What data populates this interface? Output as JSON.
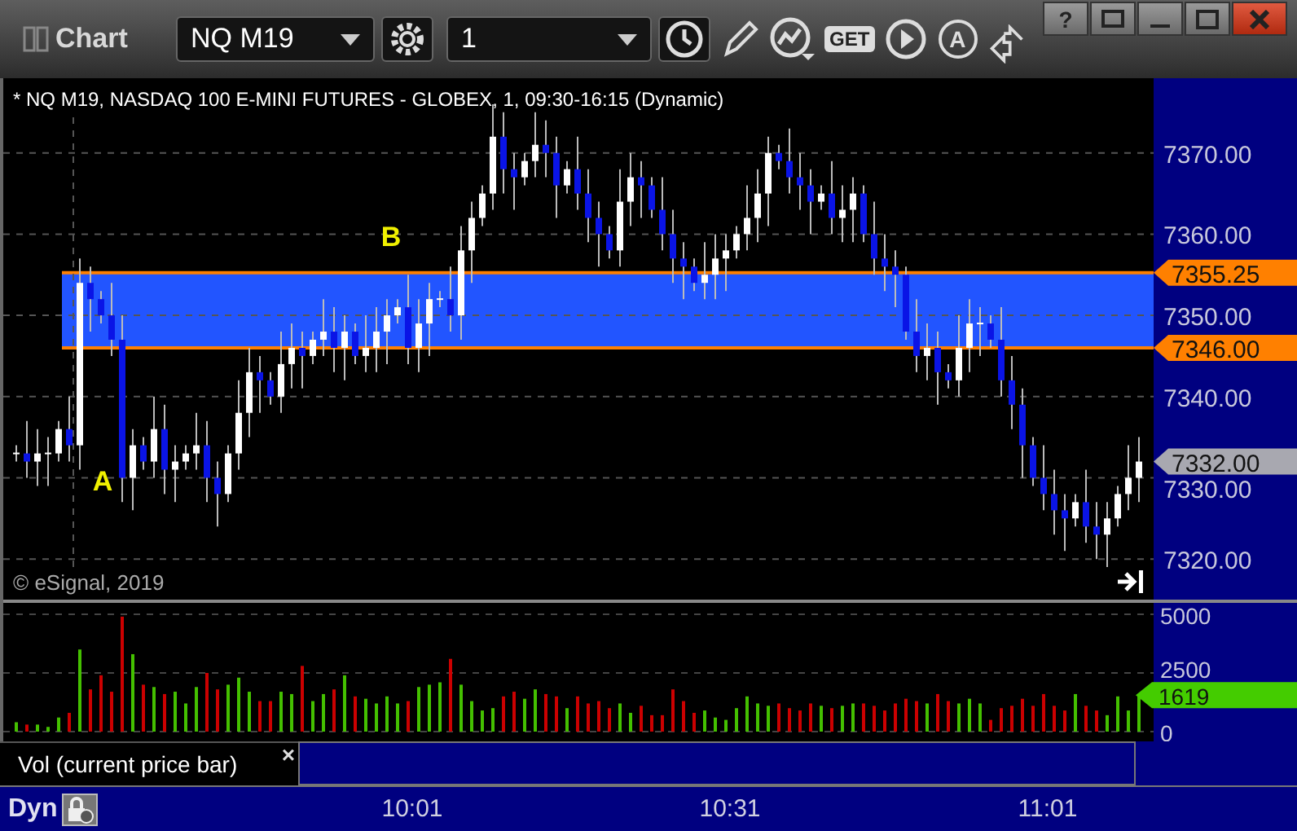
{
  "window": {
    "title": "Chart",
    "help_label": "?"
  },
  "toolbar": {
    "symbol": "NQ M19",
    "interval": "1",
    "get_label": "GET",
    "annotate_label": "A"
  },
  "price_pane": {
    "header": "* NQ M19, NASDAQ 100 E-MINI FUTURES - GLOBEX, 1, 09:30-16:15 (Dynamic)",
    "copyright": "© eSignal, 2019",
    "annotations": [
      "A",
      "B"
    ],
    "chart_data": {
      "type": "candlestick",
      "ylim": [
        7315,
        7379.2
      ],
      "grid": true,
      "yticks": [
        {
          "value": 7370,
          "label": "7370.00"
        },
        {
          "value": 7360,
          "label": "7360.00"
        },
        {
          "value": 7350,
          "label": "7350.00"
        },
        {
          "value": 7340,
          "label": "7340.00"
        },
        {
          "value": 7330,
          "label": "7330.00"
        },
        {
          "value": 7320,
          "label": "7320.00"
        }
      ],
      "ohlc": [
        [
          7333,
          7334,
          7332,
          7333
        ],
        [
          7333,
          7337,
          7330,
          7332
        ],
        [
          7332,
          7336,
          7329,
          7333
        ],
        [
          7333,
          7335,
          7329,
          7333
        ],
        [
          7333,
          7337,
          7332,
          7336
        ],
        [
          7336,
          7340,
          7332,
          7334
        ],
        [
          7334,
          7357,
          7331,
          7354
        ],
        [
          7354,
          7356,
          7348,
          7352
        ],
        [
          7352,
          7353,
          7349,
          7350
        ],
        [
          7350,
          7354,
          7345,
          7347
        ],
        [
          7347,
          7350,
          7327,
          7330
        ],
        [
          7330,
          7336,
          7326,
          7334
        ],
        [
          7334,
          7335,
          7331,
          7332
        ],
        [
          7332,
          7340,
          7330,
          7336
        ],
        [
          7336,
          7339,
          7328,
          7331
        ],
        [
          7331,
          7334,
          7327,
          7332
        ],
        [
          7332,
          7334,
          7331,
          7333
        ],
        [
          7333,
          7338,
          7331,
          7334
        ],
        [
          7334,
          7337,
          7327,
          7330
        ],
        [
          7330,
          7332,
          7324,
          7328
        ],
        [
          7328,
          7334,
          7327,
          7333
        ],
        [
          7333,
          7342,
          7331,
          7338
        ],
        [
          7338,
          7346,
          7335,
          7343
        ],
        [
          7343,
          7345,
          7338,
          7342
        ],
        [
          7342,
          7343,
          7339,
          7340
        ],
        [
          7340,
          7348,
          7338,
          7344
        ],
        [
          7344,
          7349,
          7341,
          7346
        ],
        [
          7346,
          7348,
          7341,
          7345
        ],
        [
          7345,
          7348,
          7344,
          7347
        ],
        [
          7347,
          7352,
          7345,
          7348
        ],
        [
          7348,
          7351,
          7343,
          7346
        ],
        [
          7346,
          7350,
          7342,
          7348
        ],
        [
          7348,
          7349,
          7344,
          7345
        ],
        [
          7345,
          7350,
          7343,
          7346
        ],
        [
          7346,
          7351,
          7343,
          7348
        ],
        [
          7348,
          7352,
          7344,
          7350
        ],
        [
          7350,
          7352,
          7349,
          7351
        ],
        [
          7351,
          7355,
          7344,
          7346
        ],
        [
          7346,
          7352,
          7343,
          7349
        ],
        [
          7349,
          7354,
          7345,
          7352
        ],
        [
          7352,
          7353,
          7351,
          7352
        ],
        [
          7352,
          7356,
          7348,
          7350
        ],
        [
          7350,
          7361,
          7347,
          7358
        ],
        [
          7358,
          7364,
          7354,
          7362
        ],
        [
          7362,
          7366,
          7361,
          7365
        ],
        [
          7365,
          7376,
          7363,
          7372
        ],
        [
          7372,
          7375,
          7365,
          7368
        ],
        [
          7368,
          7370,
          7363,
          7367
        ],
        [
          7367,
          7370,
          7366,
          7369
        ],
        [
          7369,
          7375,
          7367,
          7371
        ],
        [
          7371,
          7374,
          7367,
          7370
        ],
        [
          7370,
          7372,
          7362,
          7366
        ],
        [
          7366,
          7369,
          7365,
          7368
        ],
        [
          7368,
          7372,
          7363,
          7365
        ],
        [
          7365,
          7368,
          7359,
          7362
        ],
        [
          7362,
          7364,
          7356,
          7360
        ],
        [
          7360,
          7361,
          7357,
          7358
        ],
        [
          7358,
          7368,
          7356,
          7364
        ],
        [
          7364,
          7370,
          7361,
          7367
        ],
        [
          7367,
          7369,
          7362,
          7366
        ],
        [
          7366,
          7367,
          7362,
          7363
        ],
        [
          7363,
          7367,
          7358,
          7360
        ],
        [
          7360,
          7363,
          7354,
          7357
        ],
        [
          7357,
          7359,
          7352,
          7356
        ],
        [
          7356,
          7357,
          7353,
          7354
        ],
        [
          7354,
          7359,
          7352,
          7355
        ],
        [
          7355,
          7360,
          7352,
          7357
        ],
        [
          7357,
          7360,
          7353,
          7358
        ],
        [
          7358,
          7361,
          7357,
          7360
        ],
        [
          7360,
          7366,
          7358,
          7362
        ],
        [
          7362,
          7368,
          7359,
          7365
        ],
        [
          7365,
          7372,
          7361,
          7370
        ],
        [
          7370,
          7371,
          7368,
          7369
        ],
        [
          7369,
          7373,
          7365,
          7367
        ],
        [
          7367,
          7370,
          7363,
          7366
        ],
        [
          7366,
          7368,
          7360,
          7364
        ],
        [
          7364,
          7366,
          7363,
          7365
        ],
        [
          7365,
          7369,
          7360,
          7362
        ],
        [
          7362,
          7366,
          7359,
          7363
        ],
        [
          7363,
          7367,
          7359,
          7365
        ],
        [
          7365,
          7366,
          7359,
          7360
        ],
        [
          7360,
          7364,
          7355,
          7357
        ],
        [
          7357,
          7360,
          7353,
          7356
        ],
        [
          7356,
          7358,
          7351,
          7355
        ],
        [
          7355,
          7356,
          7347,
          7348
        ],
        [
          7348,
          7352,
          7343,
          7345
        ],
        [
          7345,
          7349,
          7342,
          7346
        ],
        [
          7346,
          7348,
          7339,
          7343
        ],
        [
          7343,
          7344,
          7341,
          7342
        ],
        [
          7342,
          7350,
          7340,
          7346
        ],
        [
          7346,
          7352,
          7343,
          7349
        ],
        [
          7349,
          7351,
          7345,
          7349
        ],
        [
          7349,
          7350,
          7346,
          7347
        ],
        [
          7347,
          7351,
          7340,
          7342
        ],
        [
          7342,
          7345,
          7336,
          7339
        ],
        [
          7339,
          7341,
          7330,
          7334
        ],
        [
          7334,
          7335,
          7329,
          7330
        ],
        [
          7330,
          7334,
          7326,
          7328
        ],
        [
          7328,
          7331,
          7323,
          7326
        ],
        [
          7326,
          7328,
          7321,
          7325
        ],
        [
          7325,
          7328,
          7324,
          7327
        ],
        [
          7327,
          7331,
          7322,
          7324
        ],
        [
          7324,
          7327,
          7320,
          7323
        ],
        [
          7323,
          7327,
          7319,
          7325
        ],
        [
          7325,
          7329,
          7324,
          7328
        ],
        [
          7328,
          7334,
          7326,
          7330
        ],
        [
          7330,
          7335,
          7327,
          7332
        ]
      ]
    },
    "zone_markers": [
      {
        "text": "7355.25",
        "color": "#ff8000"
      },
      {
        "text": "7346.00",
        "color": "#ff8000"
      }
    ],
    "last_price": {
      "text": "7332.00",
      "color": "#a8a8b0"
    }
  },
  "volume_pane": {
    "chart_data": {
      "type": "bar",
      "grid": true,
      "ylim": [
        0,
        5000
      ],
      "yticks": [
        0,
        2500,
        5000
      ],
      "series": [
        {
          "color": "#44c000",
          "values": [
            400,
            null,
            300,
            200,
            600,
            null,
            3500,
            null,
            null,
            null,
            null,
            3300,
            null,
            1900,
            null,
            1700,
            1200,
            1900,
            null,
            null,
            2000,
            2300,
            1700,
            null,
            null,
            1700,
            1600,
            null,
            1300,
            1600,
            null,
            2400,
            null,
            1400,
            1200,
            1500,
            1200,
            null,
            1900,
            2000,
            2100,
            null,
            2000,
            1300,
            900,
            1000,
            null,
            null,
            1400,
            1800,
            null,
            null,
            1000,
            null,
            null,
            null,
            null,
            1200,
            800,
            null,
            null,
            null,
            null,
            null,
            null,
            900,
            600,
            500,
            1000,
            1500,
            1200,
            1100,
            null,
            null,
            null,
            null,
            1100,
            null,
            1100,
            1200,
            null,
            null,
            null,
            null,
            null,
            null,
            1200,
            null,
            null,
            1200,
            1400,
            1200,
            null,
            null,
            null,
            null,
            null,
            null,
            null,
            null,
            1600,
            null,
            null,
            700,
            1500,
            900,
            1600
          ]
        },
        {
          "color": "#cc0000",
          "values": [
            null,
            300,
            null,
            null,
            null,
            800,
            null,
            1800,
            2400,
            1700,
            4900,
            null,
            2000,
            null,
            1600,
            null,
            null,
            null,
            2500,
            1800,
            null,
            null,
            null,
            1300,
            1300,
            null,
            null,
            2800,
            null,
            null,
            1800,
            null,
            1500,
            null,
            null,
            null,
            null,
            1300,
            null,
            null,
            null,
            3100,
            null,
            null,
            null,
            null,
            1500,
            1700,
            null,
            null,
            1600,
            1500,
            null,
            1500,
            1200,
            1300,
            1000,
            null,
            null,
            1100,
            700,
            700,
            1800,
            1300,
            800,
            null,
            null,
            null,
            null,
            null,
            null,
            null,
            1200,
            1000,
            900,
            1200,
            null,
            1000,
            null,
            null,
            1200,
            1100,
            900,
            1200,
            1400,
            1300,
            null,
            1600,
            1300,
            null,
            null,
            null,
            500,
            1000,
            1100,
            1400,
            1100,
            1600,
            1100,
            900,
            null,
            1100,
            900,
            null,
            null,
            null,
            null
          ]
        }
      ]
    },
    "marker": {
      "text": "1619",
      "color": "#44cc00"
    },
    "legend": "Vol (current price bar)",
    "close_label": "×"
  },
  "bottom_bar": {
    "mode": "Dyn",
    "time_labels": [
      "10:01",
      "10:31",
      "11:01"
    ]
  }
}
